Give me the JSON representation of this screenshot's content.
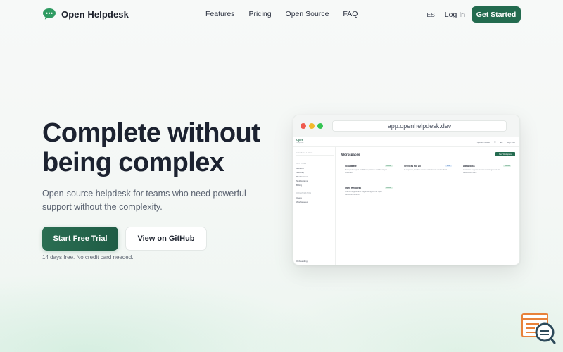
{
  "nav": {
    "brand": "Open Helpdesk",
    "links": [
      "Features",
      "Pricing",
      "Open Source",
      "FAQ"
    ],
    "language": "ES",
    "login": "Log In",
    "cta": "Get Started"
  },
  "hero": {
    "title": "Complete without being complex",
    "subtitle": "Open-source helpdesk for teams who need powerful support without the complexity.",
    "primary_button": "Start Free Trial",
    "secondary_button": "View on GitHub",
    "note": "14 days free. No credit card needed."
  },
  "app_preview": {
    "url": "app.openhelpdesk.dev",
    "brand": "Open",
    "brand_sub": "Helpdesk",
    "top_right": [
      "Spotlite Mode",
      "☰",
      "En",
      "Sign Out"
    ],
    "search_placeholder": "Search for a ticket...",
    "sidebar": {
      "section1_header": "SETTINGS",
      "section1_items": [
        "General",
        "Security",
        "Preferences",
        "Notifications",
        "Billing"
      ],
      "section2_header": "ORGANIZATION",
      "section2_items": [
        "Users",
        "Workspaces"
      ],
      "footer": "Onboarding"
    },
    "workspaces_title": "Workspaces",
    "new_workspace_button": "New Workspace",
    "cards": [
      {
        "name": "CloudBase",
        "badge": "Active",
        "desc": "Managed support for API integrations and developer customers"
      },
      {
        "name": "Services For All",
        "badge": "Beta",
        "desc": "IT requests, facilities issues and internal service desk"
      },
      {
        "name": "DataWorks",
        "badge": "Active",
        "desc": "Customer support and issue management for DataWorks team"
      },
      {
        "name": "Open Helpdesk",
        "badge": "Active",
        "desc": "Internal support and bug tracking for the Open Helpdesk platform"
      }
    ]
  },
  "colors": {
    "brand_green": "#236b4f",
    "text_dark": "#1c2230",
    "text_muted": "#5a6270"
  }
}
